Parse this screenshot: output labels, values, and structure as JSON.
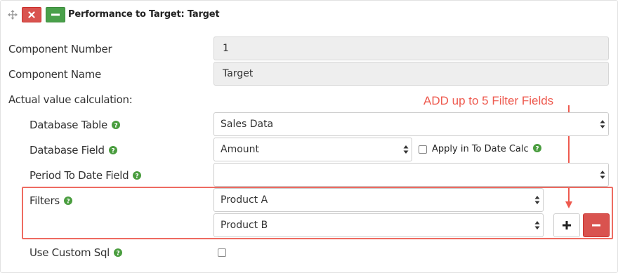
{
  "header": {
    "title": "Performance to Target: Target",
    "move_icon": "move-icon",
    "delete_icon": "close-icon",
    "collapse_icon": "minus-icon"
  },
  "fields": {
    "component_number": {
      "label": "Component Number",
      "value": "1"
    },
    "component_name": {
      "label": "Component Name",
      "value": "Target"
    },
    "actual_value_heading": "Actual value calculation:",
    "database_table": {
      "label": "Database Table",
      "value": "Sales Data"
    },
    "database_field": {
      "label": "Database Field",
      "value": "Amount"
    },
    "apply_to_date": {
      "label": "Apply in To Date Calc",
      "checked": false
    },
    "period_to_date": {
      "label": "Period To Date Field",
      "value": ""
    },
    "filters": {
      "label": "Filters",
      "values": [
        "Product A",
        "Product B"
      ]
    },
    "use_custom_sql": {
      "label": "Use Custom Sql",
      "checked": false
    }
  },
  "annotation": {
    "text": "ADD up to 5 Filter Fields"
  },
  "colors": {
    "danger": "#d9534f",
    "success": "#49a04a",
    "help": "#4a9d3f",
    "annotation": "#ee5a4f"
  }
}
